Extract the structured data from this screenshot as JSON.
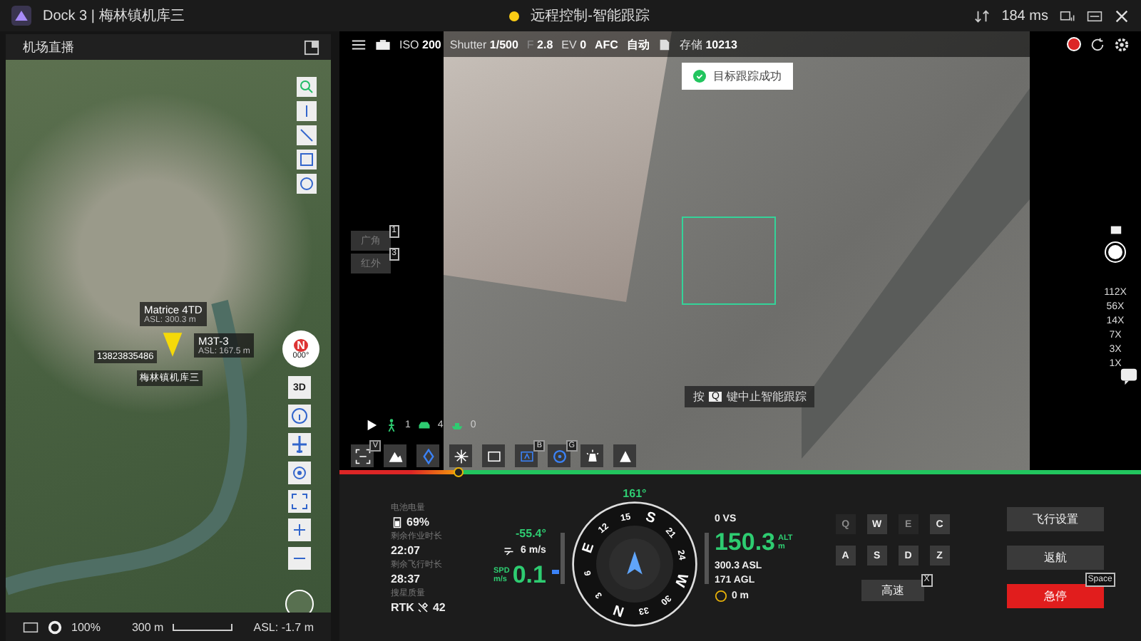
{
  "window": {
    "title": "Dock 3 | 梅林镇机库三",
    "status": "远程控制-智能跟踪",
    "latency": "184 ms"
  },
  "map_panel": {
    "title": "机场直播",
    "aircraft": [
      {
        "name": "Matrice 4TD",
        "altitude": "ASL: 300.3 m"
      },
      {
        "name": "M3T-3",
        "altitude": "ASL: 167.5 m"
      }
    ],
    "phone": "13823835486",
    "dock_label": "梅林镇机库三",
    "compass": {
      "letter": "N",
      "heading": "000°"
    },
    "view_button": "3D",
    "footer": {
      "opacity": "100%",
      "scale": "300 m",
      "altitude": "ASL: -1.7 m"
    }
  },
  "camera": {
    "settings": [
      {
        "label": "ISO",
        "value": "200"
      },
      {
        "label": "Shutter",
        "value": "1/500"
      },
      {
        "label": "F",
        "value": "2.8"
      },
      {
        "label": "EV",
        "value": "0"
      }
    ],
    "focus_mode": "AFC",
    "exposure_mode": "自动",
    "storage": {
      "label": "存储",
      "value": "10213"
    },
    "recording": true
  },
  "toast": "目标跟踪成功",
  "lenses": [
    {
      "label": "广角",
      "key": "1"
    },
    {
      "label": "红外",
      "key": "3"
    }
  ],
  "detections": [
    {
      "kind": "person",
      "count": "1"
    },
    {
      "kind": "car",
      "count": "4"
    },
    {
      "kind": "boat",
      "count": "0"
    }
  ],
  "tracking_hint": {
    "prefix": "按",
    "key": "Q",
    "text": "键中止智能跟踪"
  },
  "zoom_levels": [
    "112X",
    "56X",
    "14X",
    "7X",
    "3X",
    "1X"
  ],
  "tools": [
    {
      "kind": "fullscreen",
      "key": "V"
    },
    {
      "kind": "ar-map"
    },
    {
      "kind": "diamond"
    },
    {
      "kind": "light"
    },
    {
      "kind": "ar"
    },
    {
      "kind": "ai",
      "key": "B"
    },
    {
      "kind": "target",
      "key": "G"
    },
    {
      "kind": "spotlight"
    },
    {
      "kind": "beacon"
    }
  ],
  "progress": {
    "level": 0.15
  },
  "telemetry": [
    {
      "kind": "battery",
      "label": "电池电量",
      "value": "69%"
    },
    {
      "kind": "text",
      "label": "剩余作业时长",
      "value": "22:07"
    },
    {
      "kind": "text",
      "label": "剩余飞行时长",
      "value": "28:37"
    },
    {
      "kind": "rtk",
      "label": "搜星质量",
      "value": "RTK",
      "count": "42"
    }
  ],
  "flight": {
    "heading": "161°",
    "pitch": "-55.4°",
    "wind": "6 m/s",
    "speed_label": "SPD",
    "speed_unit": "m/s",
    "speed": "0.1",
    "vertical_speed": "0 VS",
    "altitude": "150.3",
    "altitude_label": "ALT",
    "altitude_unit": "m",
    "asl": "300.3 ASL",
    "agl": "171 AGL",
    "distance": "0 m",
    "compass_marks": [
      "N",
      "3",
      "6",
      "E",
      "12",
      "15",
      "S",
      "21",
      "24",
      "W",
      "30",
      "33"
    ]
  },
  "keys": [
    {
      "label": "Q",
      "disabled": true
    },
    {
      "label": "W",
      "disabled": false
    },
    {
      "label": "E",
      "disabled": true
    },
    {
      "label": "C",
      "disabled": false
    },
    {
      "label": "A",
      "disabled": false
    },
    {
      "label": "S",
      "disabled": false
    },
    {
      "label": "D",
      "disabled": false
    },
    {
      "label": "Z",
      "disabled": false
    }
  ],
  "speed_button": {
    "label": "高速",
    "key": "X"
  },
  "actions": [
    {
      "kind": "normal",
      "label": "飞行设置"
    },
    {
      "kind": "normal",
      "label": "返航"
    },
    {
      "kind": "danger",
      "label": "急停",
      "key": "Space"
    }
  ]
}
